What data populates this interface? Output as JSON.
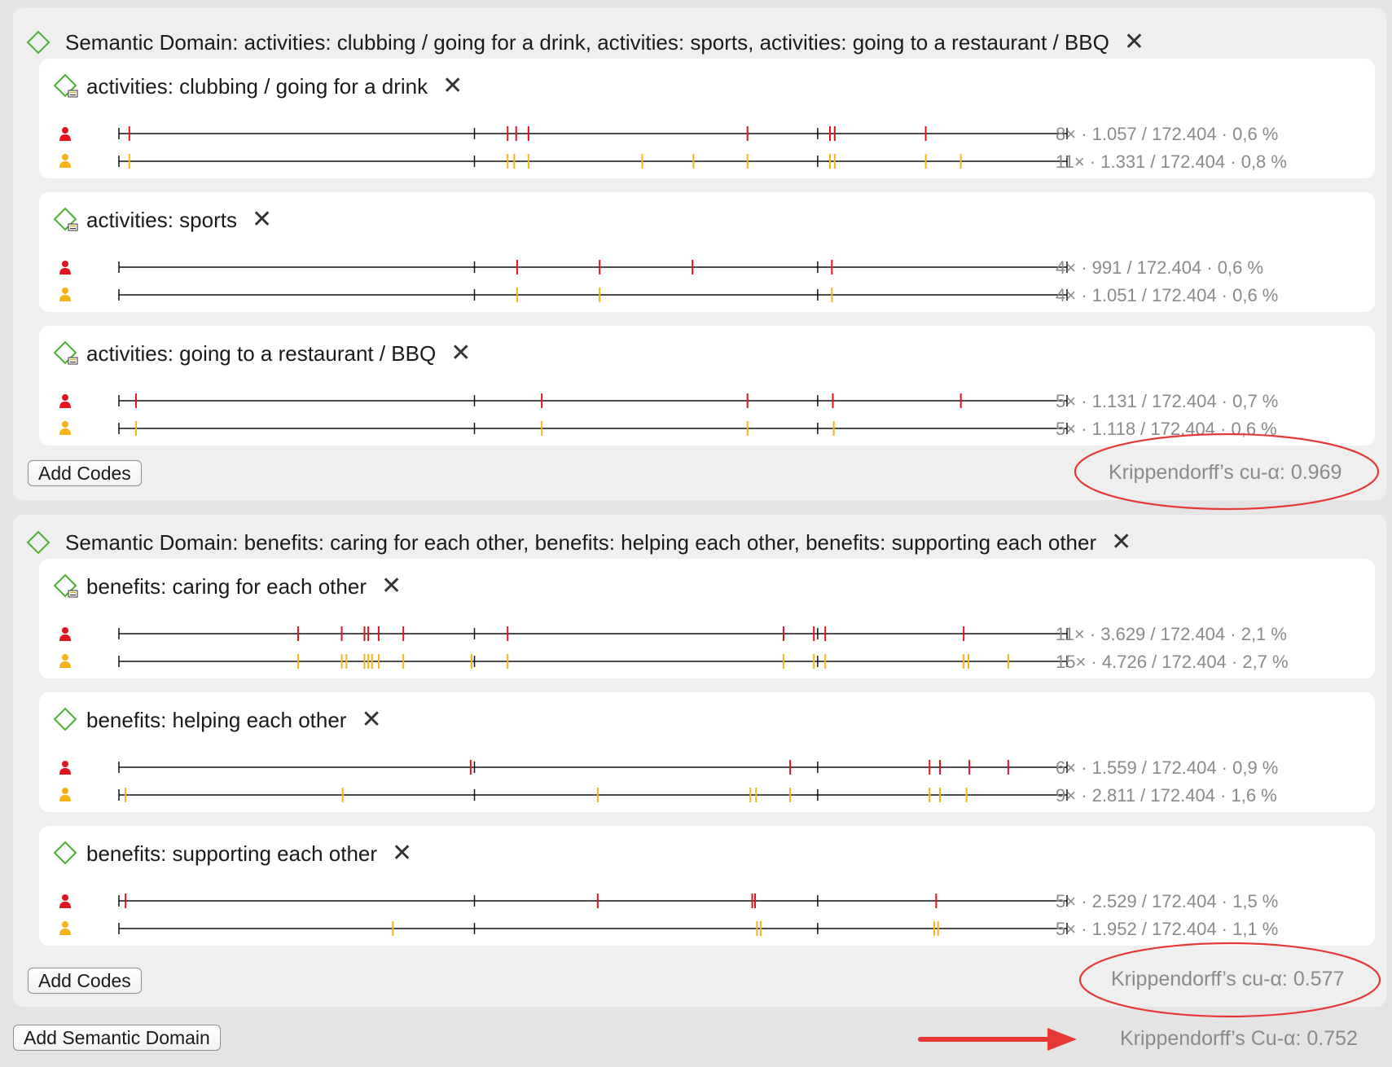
{
  "total_length": 172404,
  "colors": {
    "coder1": "#e0141e",
    "coder2": "#f5b318",
    "domain_icon": "#4caf32",
    "annotation": "#e53935"
  },
  "domains": [
    {
      "title": "Semantic Domain: activities: clubbing / going for a drink, activities: sports, activities: going to a restaurant / BBQ",
      "add_codes_label": "Add Codes",
      "alpha_label": "Krippendorff’s cu-α: 0.969",
      "codes": [
        {
          "title": "activities: clubbing / going for a drink",
          "coders": [
            {
              "color": "#e0141e",
              "stats": "8× · 1.057 / 172.404 · 0,6 %",
              "marks": [
                0.011,
                0.41,
                0.419,
                0.432,
                0.663,
                0.75,
                0.755,
                0.851
              ]
            },
            {
              "color": "#f5b318",
              "stats": "11× · 1.331 / 172.404 · 0,8 %",
              "marks": [
                0.011,
                0.41,
                0.417,
                0.432,
                0.552,
                0.606,
                0.663,
                0.75,
                0.755,
                0.851,
                0.888
              ]
            }
          ]
        },
        {
          "title": "activities: sports",
          "coders": [
            {
              "color": "#e0141e",
              "stats": "4× · 991 / 172.404 · 0,6 %",
              "marks": [
                0.42,
                0.507,
                0.605,
                0.752
              ]
            },
            {
              "color": "#f5b318",
              "stats": "4× · 1.051 / 172.404 · 0,6 %",
              "marks": [
                0.42,
                0.507,
                0.752
              ]
            }
          ]
        },
        {
          "title": "activities: going to a restaurant / BBQ",
          "coders": [
            {
              "color": "#e0141e",
              "stats": "5× · 1.131 / 172.404 · 0,7 %",
              "marks": [
                0.018,
                0.446,
                0.663,
                0.753,
                0.888
              ]
            },
            {
              "color": "#f5b318",
              "stats": "5× · 1.118 / 172.404 · 0,6 %",
              "marks": [
                0.018,
                0.446,
                0.663,
                0.754
              ]
            }
          ]
        }
      ]
    },
    {
      "title": "Semantic Domain: benefits: caring for each other, benefits: helping each other, benefits: supporting each other",
      "add_codes_label": "Add Codes",
      "alpha_label": "Krippendorff’s cu-α: 0.577",
      "codes": [
        {
          "title": "benefits: caring for each other",
          "coders": [
            {
              "color": "#e0141e",
              "stats": "11× · 3.629 / 172.404 · 2,1 %",
              "marks": [
                0.189,
                0.235,
                0.259,
                0.263,
                0.274,
                0.3,
                0.41,
                0.701,
                0.733,
                0.745,
                0.891
              ]
            },
            {
              "color": "#f5b318",
              "stats": "15× · 4.726 / 172.404 · 2,7 %",
              "marks": [
                0.189,
                0.235,
                0.24,
                0.259,
                0.263,
                0.267,
                0.274,
                0.3,
                0.372,
                0.41,
                0.701,
                0.733,
                0.745,
                0.891,
                0.896,
                0.938
              ]
            }
          ]
        },
        {
          "title": "benefits: helping each other",
          "coders": [
            {
              "color": "#e0141e",
              "stats": "6× · 1.559 / 172.404 · 0,9 %",
              "marks": [
                0.371,
                0.708,
                0.855,
                0.866,
                0.897,
                0.938
              ]
            },
            {
              "color": "#f5b318",
              "stats": "9× · 2.811 / 172.404 · 1,6 %",
              "marks": [
                0.007,
                0.236,
                0.505,
                0.666,
                0.672,
                0.708,
                0.855,
                0.866,
                0.894
              ]
            }
          ]
        },
        {
          "title": "benefits: supporting each other",
          "coders": [
            {
              "color": "#e0141e",
              "stats": "5× · 2.529 / 172.404 · 1,5 %",
              "marks": [
                0.007,
                0.505,
                0.668,
                0.671,
                0.862
              ]
            },
            {
              "color": "#f5b318",
              "stats": "5× · 1.952 / 172.404 · 1,1 %",
              "marks": [
                0.289,
                0.673,
                0.677,
                0.86,
                0.864
              ]
            }
          ]
        }
      ]
    }
  ],
  "footer": {
    "add_domain_label": "Add Semantic Domain",
    "overall_alpha_label": "Krippendorff’s Cu-α: 0.752"
  }
}
